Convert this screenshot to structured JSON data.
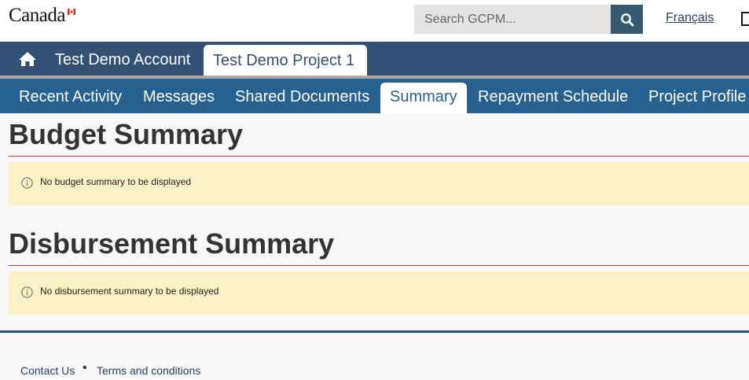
{
  "header": {
    "logo_text": "Canada",
    "search_placeholder": "Search GCPM...",
    "language_link": "Français"
  },
  "account_bar": {
    "account_name": "Test Demo Account",
    "project_tab": "Test Demo Project 1"
  },
  "nav": {
    "items": [
      {
        "label": "Recent Activity"
      },
      {
        "label": "Messages"
      },
      {
        "label": "Shared Documents"
      },
      {
        "label": "Summary",
        "active": true
      },
      {
        "label": "Repayment Schedule"
      },
      {
        "label": "Project Profile"
      }
    ]
  },
  "sections": [
    {
      "title": "Budget Summary",
      "message": "No budget summary to be displayed"
    },
    {
      "title": "Disbursement Summary",
      "message": "No disbursement summary to be displayed"
    }
  ],
  "footer": {
    "links": [
      {
        "label": "Contact Us"
      },
      {
        "label": "Terms and conditions"
      }
    ],
    "separator": "•"
  },
  "colors": {
    "header_bg": "#ffffff",
    "account_bar_bg": "#335075",
    "nav_bg": "#26618f",
    "alert_bg": "#fcf0c6",
    "rule_red": "#af3c43",
    "search_button_bg": "#36596f"
  }
}
